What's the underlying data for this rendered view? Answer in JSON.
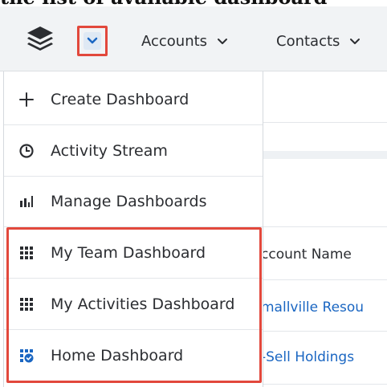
{
  "caption": {
    "text": "the list of available dashboard"
  },
  "navbar": {
    "logo_icon": "stacked-layers-logo",
    "dropdown_toggle_icon": "chevron-down-icon",
    "items": [
      {
        "label": "Accounts",
        "icon": "chevron-down-icon"
      },
      {
        "label": "Contacts",
        "icon": "chevron-down-icon"
      }
    ]
  },
  "dropdown": {
    "items": [
      {
        "label": "Create Dashboard",
        "icon": "plus-icon"
      },
      {
        "label": "Activity Stream",
        "icon": "clock-icon"
      },
      {
        "label": "Manage Dashboards",
        "icon": "bar-chart-icon"
      },
      {
        "label": "My Team Dashboard",
        "icon": "grid-icon"
      },
      {
        "label": "My Activities Dashboard",
        "icon": "grid-icon"
      },
      {
        "label": "Home Dashboard",
        "icon": "home-dashboard-icon"
      }
    ]
  },
  "background_list": {
    "column_header": "ccount Name",
    "rows": [
      "mallville Resou",
      "-Sell Holdings"
    ]
  },
  "colors": {
    "highlight": "#e2483c",
    "link": "#1a66c2",
    "navbar_bg": "#f1f3f5",
    "accent_blue": "#1a66c2"
  }
}
